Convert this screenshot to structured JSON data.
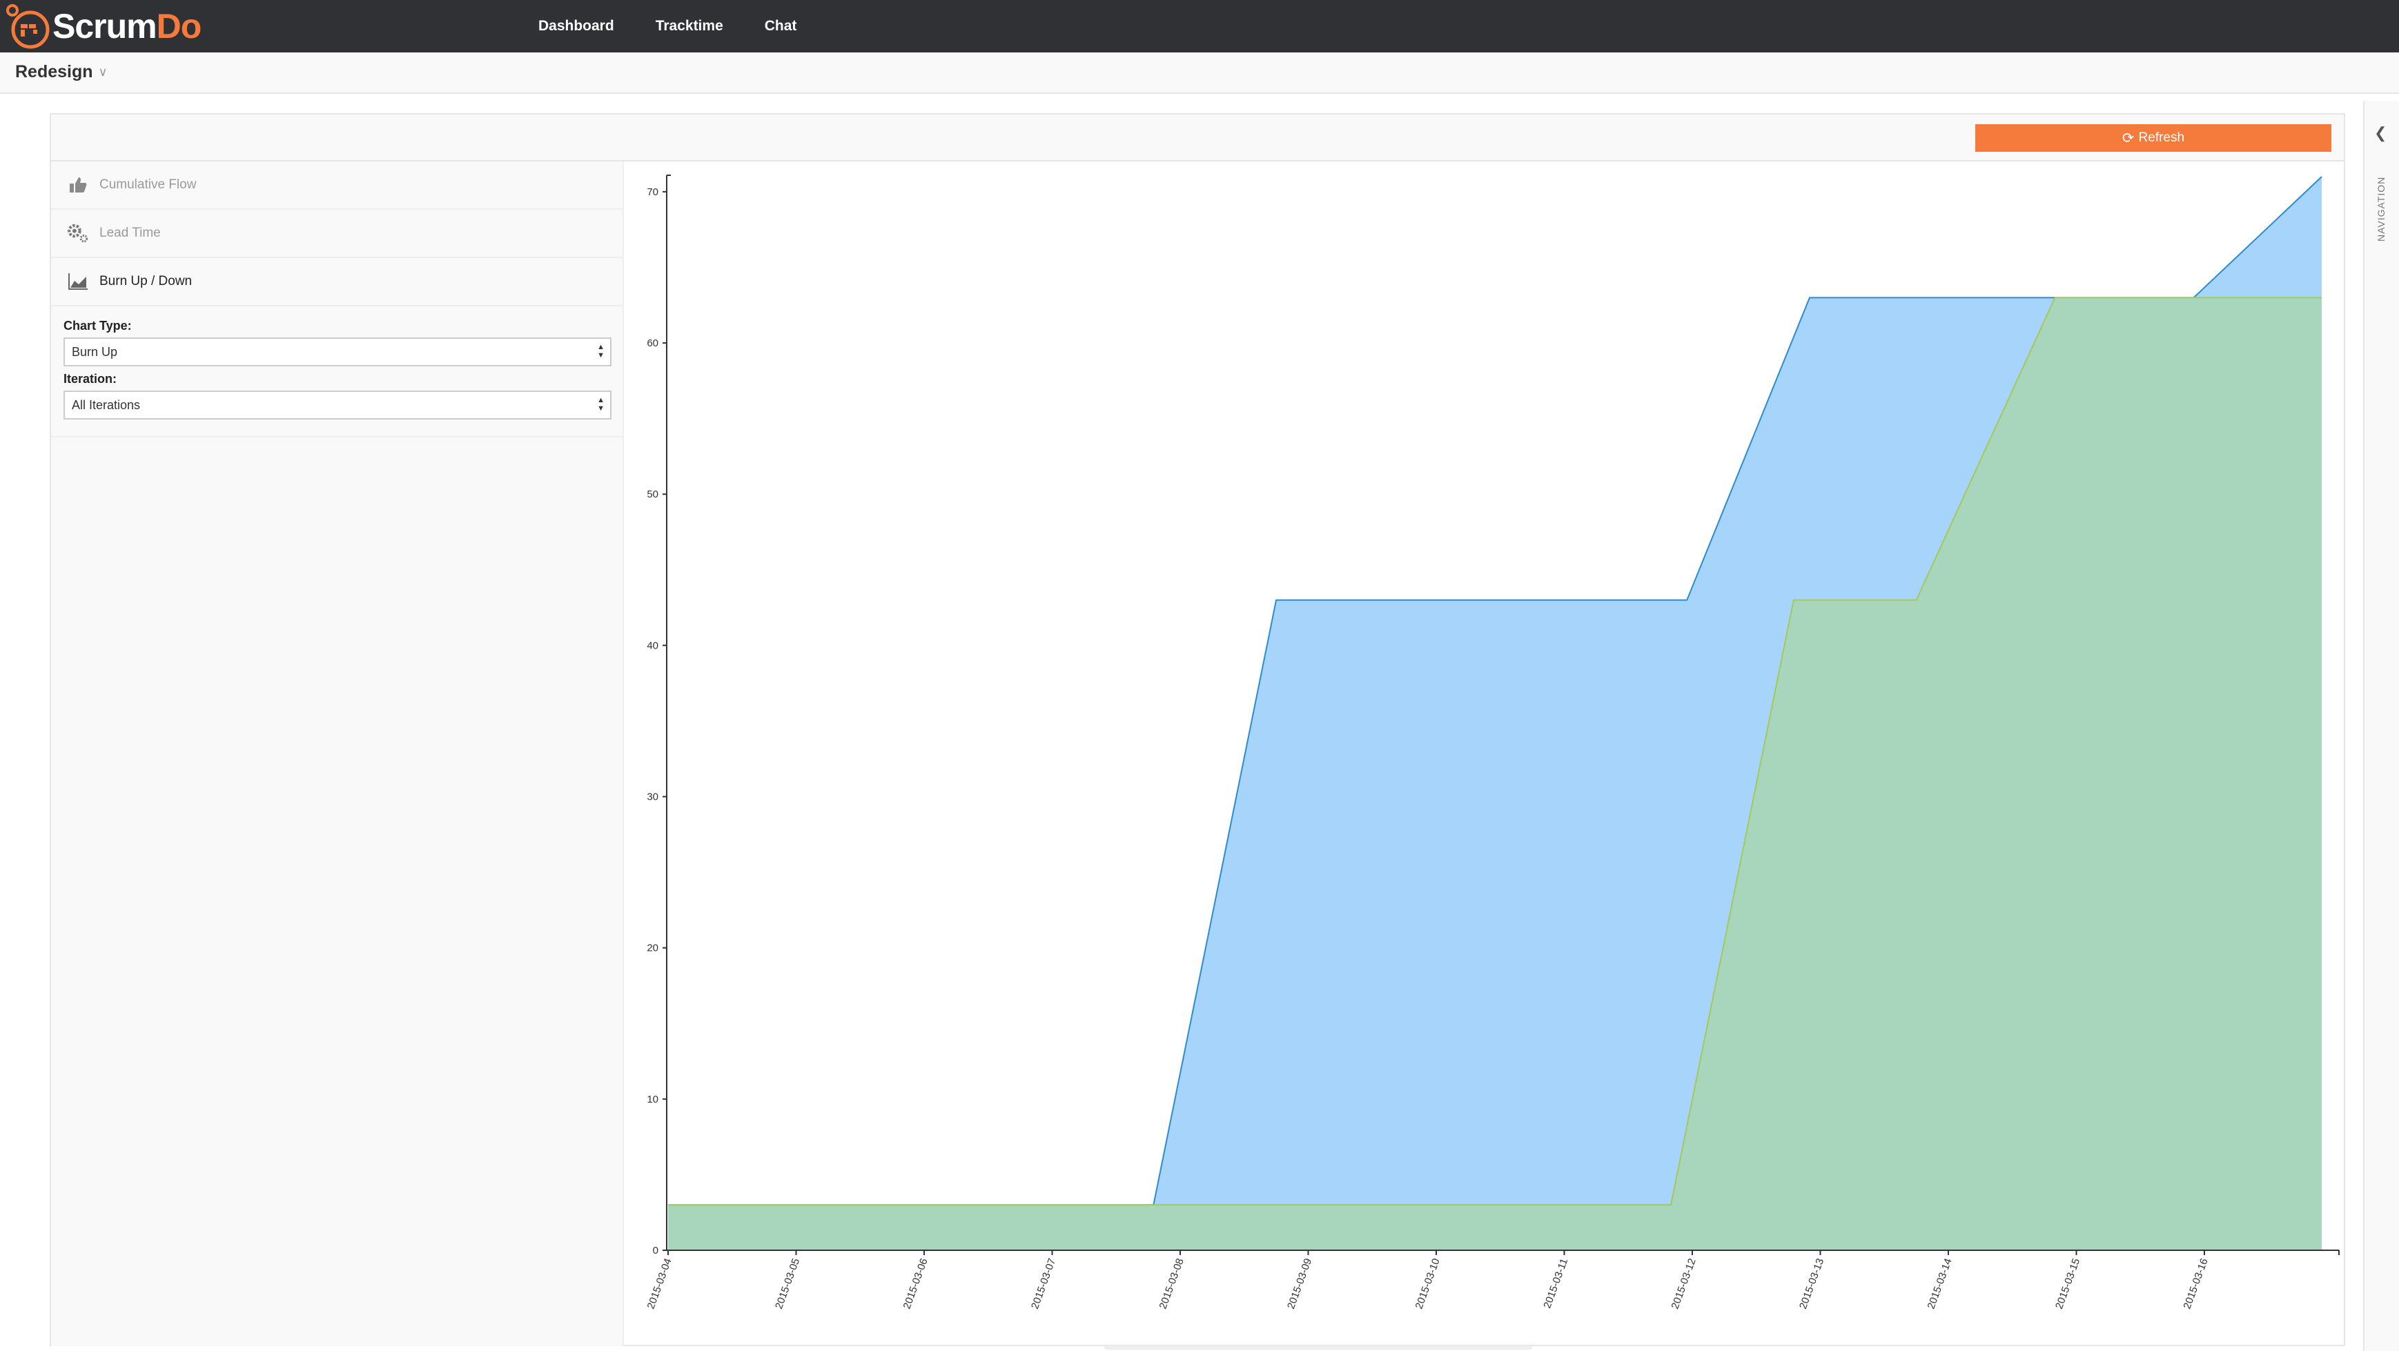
{
  "app": {
    "logo_scrum": "Scrum",
    "logo_do": "Do",
    "nav": [
      "Dashboard",
      "Tracktime",
      "Chat"
    ]
  },
  "project": {
    "title": "Redesign"
  },
  "toolbar": {
    "refresh_label": "Refresh"
  },
  "sidebar": {
    "items": [
      {
        "label": "Cumulative Flow",
        "icon": "thumbs-up-icon"
      },
      {
        "label": "Lead Time",
        "icon": "gears-icon"
      },
      {
        "label": "Burn Up / Down",
        "icon": "area-chart-icon"
      }
    ],
    "chart_type_label": "Chart Type:",
    "chart_type_value": "Burn Up",
    "iteration_label": "Iteration:",
    "iteration_value": "All Iterations"
  },
  "right_tab": {
    "label": "NAVIGATION"
  },
  "colors": {
    "accent": "#f57b3c",
    "navbar": "#2f3134",
    "total_fill": "#a6d4fb",
    "total_stroke": "#2a8bd6",
    "done_fill": "#a8d6bc",
    "done_stroke": "#a6c955"
  },
  "chart_data": {
    "type": "area",
    "title": "",
    "xlabel": "",
    "ylabel": "",
    "ylim": [
      0,
      71
    ],
    "grid": false,
    "x_ticks": [
      "2015-03-04",
      "2015-03-05",
      "2015-03-06",
      "2015-03-07",
      "2015-03-08",
      "2015-03-09",
      "2015-03-10",
      "2015-03-11",
      "2015-03-12",
      "2015-03-13",
      "2015-03-14",
      "2015-03-15",
      "2015-03-16"
    ],
    "y_ticks": [
      0,
      10,
      20,
      30,
      40,
      50,
      60,
      70
    ],
    "series": [
      {
        "x": [
          "2015-03-04",
          "2015-03-07 19:00",
          "2015-03-08 18:00",
          "2015-03-11 23:00",
          "2015-03-12 22:00",
          "2015-03-13 21:00",
          "2015-03-15 22:00",
          "2015-03-16 22:00"
        ],
        "y": [
          3,
          3,
          43,
          43,
          63,
          63,
          63,
          71
        ]
      },
      {
        "x": [
          "2015-03-04",
          "2015-03-11 20:00",
          "2015-03-12 19:00",
          "2015-03-13 18:00",
          "2015-03-14 20:00",
          "2015-03-16 22:00"
        ],
        "y": [
          3,
          3,
          43,
          43,
          63,
          63
        ]
      }
    ]
  }
}
